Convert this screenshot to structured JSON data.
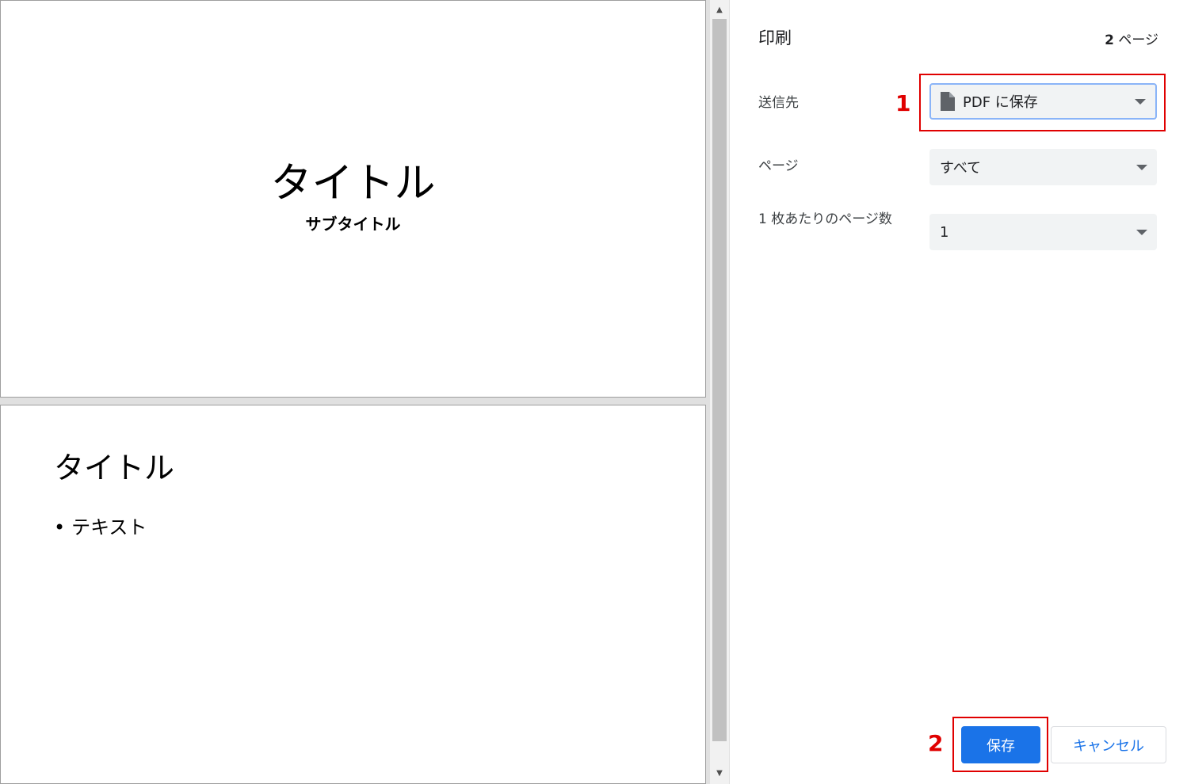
{
  "preview": {
    "page1": {
      "title": "タイトル",
      "subtitle": "サブタイトル"
    },
    "page2": {
      "title": "タイトル",
      "bullet_mark": "•",
      "bullet_text": "テキスト"
    }
  },
  "panel": {
    "title": "印刷",
    "page_count_number": "2",
    "page_count_unit": "ページ",
    "destination": {
      "label": "送信先",
      "value": "PDF に保存",
      "icon": "document-icon"
    },
    "pages": {
      "label": "ページ",
      "value": "すべて"
    },
    "pages_per_sheet": {
      "label": "1 枚あたりのページ数",
      "value": "1"
    },
    "buttons": {
      "save": "保存",
      "cancel": "キャンセル"
    }
  },
  "annotations": {
    "step1": "1",
    "step2": "2",
    "color": "#e00000"
  },
  "colors": {
    "accent": "#1a73e8",
    "select_bg": "#f1f3f4",
    "focus_border": "#8ab4f8"
  }
}
